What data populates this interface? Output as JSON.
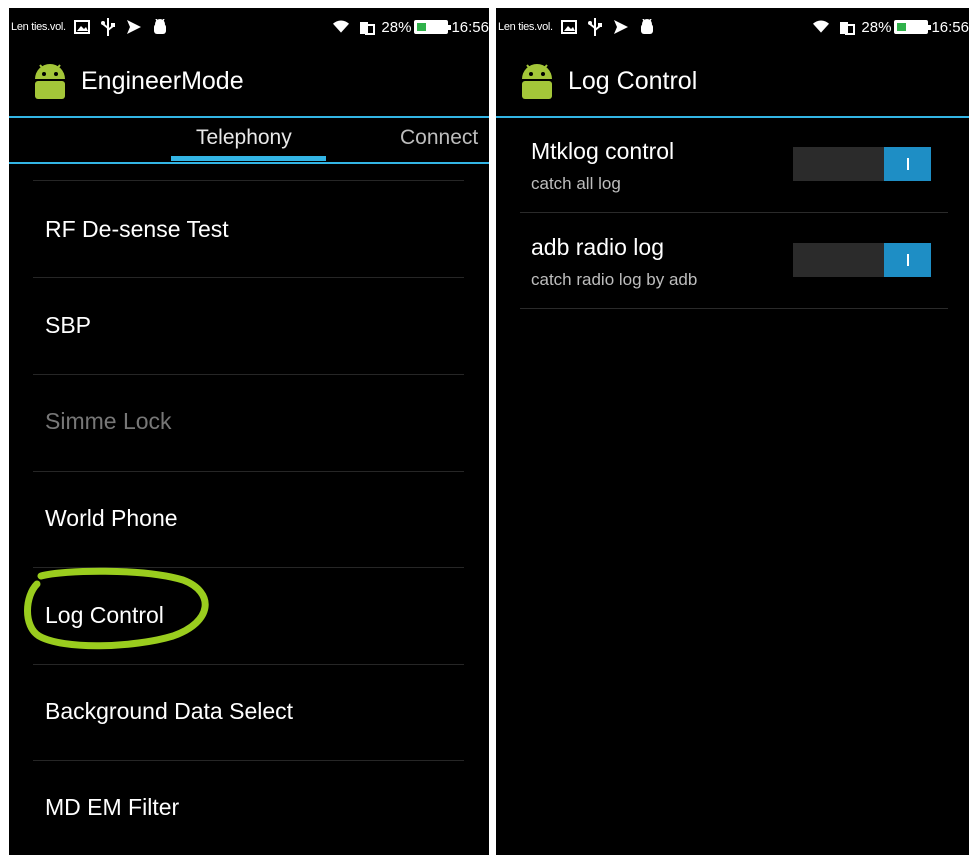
{
  "left": {
    "statusbar": {
      "carrier": "Len ties.vol.",
      "battery_pct": "28%",
      "battery_fraction": 0.28,
      "time": "16:56"
    },
    "app_title": "EngineerMode",
    "tabs": {
      "active": "Telephony",
      "next": "Connect"
    },
    "items": [
      {
        "label": "RF De-sense Test",
        "enabled": true
      },
      {
        "label": "SBP",
        "enabled": true
      },
      {
        "label": "Simme Lock",
        "enabled": false
      },
      {
        "label": "World Phone",
        "enabled": true
      },
      {
        "label": "Log Control",
        "enabled": true,
        "highlighted": true
      },
      {
        "label": "Background Data Select",
        "enabled": true
      },
      {
        "label": "MD EM Filter",
        "enabled": true
      }
    ]
  },
  "right": {
    "statusbar": {
      "carrier": "Len ties.vol.",
      "battery_pct": "28%",
      "battery_fraction": 0.28,
      "time": "16:56"
    },
    "app_title": "Log Control",
    "prefs": [
      {
        "title": "Mtklog control",
        "summary": "catch all log",
        "checked": true
      },
      {
        "title": "adb radio log",
        "summary": "catch radio log by adb",
        "checked": true
      }
    ]
  },
  "colors": {
    "accent": "#33b5e5",
    "switch_on": "#1e8ec5",
    "highlight_circle": "#9acd1e",
    "android_green": "#a4c639",
    "battery_green": "#2fb14a"
  },
  "icons": [
    "image-icon",
    "usb-icon",
    "send-icon",
    "android-debug-icon",
    "wifi-icon",
    "phone-icon",
    "battery-icon",
    "android-app-icon"
  ]
}
